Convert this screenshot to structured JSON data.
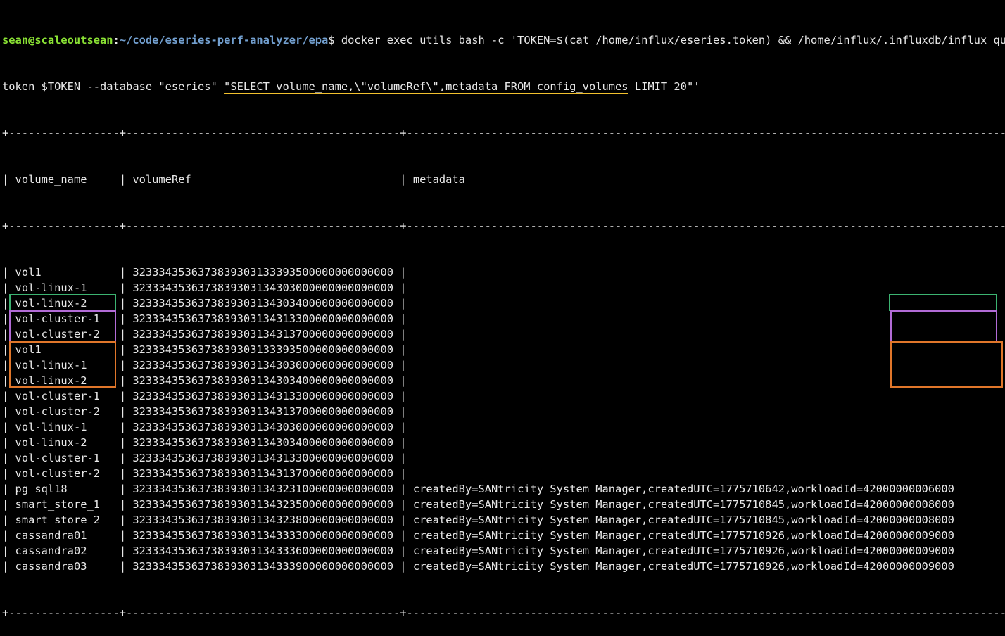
{
  "prompt": {
    "user_host": "sean@scaleoutsean",
    "colon": ":",
    "path": "~/code/eseries-perf-analyzer/epa",
    "dollar": "$",
    "command_line1": " docker exec utils bash -c 'TOKEN=$(cat /home/influx/eseries.token) && /home/influx/.influxdb/influx query --",
    "command_line2_pre": "token $TOKEN --database \"eseries\" ",
    "command_line2_hl": "\"SELECT volume_name,\\\"volumeRef\\\",metadata FROM config_volumes",
    "command_line2_post": " LIMIT 20\"'"
  },
  "table": {
    "border": "+-----------------+------------------------------------------+------------------------------------------------------------------------------------------------------------",
    "headers": {
      "volume_name": "volume_name",
      "volumeRef": "volumeRef",
      "metadata": "metadata"
    },
    "rows": [
      {
        "volume_name": "vol1",
        "volumeRef": "3233343536373839303133393500000000000000",
        "metadata": ""
      },
      {
        "volume_name": "vol-linux-1",
        "volumeRef": "3233343536373839303134303000000000000000",
        "metadata": ""
      },
      {
        "volume_name": "vol-linux-2",
        "volumeRef": "3233343536373839303134303400000000000000",
        "metadata": ""
      },
      {
        "volume_name": "vol-cluster-1",
        "volumeRef": "3233343536373839303134313300000000000000",
        "metadata": ""
      },
      {
        "volume_name": "vol-cluster-2",
        "volumeRef": "3233343536373839303134313700000000000000",
        "metadata": ""
      },
      {
        "volume_name": "vol1",
        "volumeRef": "3233343536373839303133393500000000000000",
        "metadata": ""
      },
      {
        "volume_name": "vol-linux-1",
        "volumeRef": "3233343536373839303134303000000000000000",
        "metadata": ""
      },
      {
        "volume_name": "vol-linux-2",
        "volumeRef": "3233343536373839303134303400000000000000",
        "metadata": ""
      },
      {
        "volume_name": "vol-cluster-1",
        "volumeRef": "3233343536373839303134313300000000000000",
        "metadata": ""
      },
      {
        "volume_name": "vol-cluster-2",
        "volumeRef": "3233343536373839303134313700000000000000",
        "metadata": ""
      },
      {
        "volume_name": "vol-linux-1",
        "volumeRef": "3233343536373839303134303000000000000000",
        "metadata": ""
      },
      {
        "volume_name": "vol-linux-2",
        "volumeRef": "3233343536373839303134303400000000000000",
        "metadata": ""
      },
      {
        "volume_name": "vol-cluster-1",
        "volumeRef": "3233343536373839303134313300000000000000",
        "metadata": ""
      },
      {
        "volume_name": "vol-cluster-2",
        "volumeRef": "3233343536373839303134313700000000000000",
        "metadata": ""
      },
      {
        "volume_name": "pg_sql18",
        "volumeRef": "3233343536373839303134323100000000000000",
        "metadata": "createdBy=SANtricity System Manager,createdUTC=1775710642,workloadId=42000000006000"
      },
      {
        "volume_name": "smart_store_1",
        "volumeRef": "3233343536373839303134323500000000000000",
        "metadata": "createdBy=SANtricity System Manager,createdUTC=1775710845,workloadId=42000000008000"
      },
      {
        "volume_name": "smart_store_2",
        "volumeRef": "3233343536373839303134323800000000000000",
        "metadata": "createdBy=SANtricity System Manager,createdUTC=1775710845,workloadId=42000000008000"
      },
      {
        "volume_name": "cassandra01",
        "volumeRef": "3233343536373839303134333300000000000000",
        "metadata": "createdBy=SANtricity System Manager,createdUTC=1775710926,workloadId=42000000009000"
      },
      {
        "volume_name": "cassandra02",
        "volumeRef": "3233343536373839303134333600000000000000",
        "metadata": "createdBy=SANtricity System Manager,createdUTC=1775710926,workloadId=42000000009000"
      },
      {
        "volume_name": "cassandra03",
        "volumeRef": "3233343536373839303134333900000000000000",
        "metadata": "createdBy=SANtricity System Manager,createdUTC=1775710926,workloadId=42000000009000"
      }
    ]
  },
  "colors": {
    "user": "#8ae234",
    "path": "#729fcf",
    "highlight_underline": "#f2c12e",
    "box_green": "#3cb371",
    "box_purple": "#b26bd6",
    "box_orange": "#e0762a"
  }
}
